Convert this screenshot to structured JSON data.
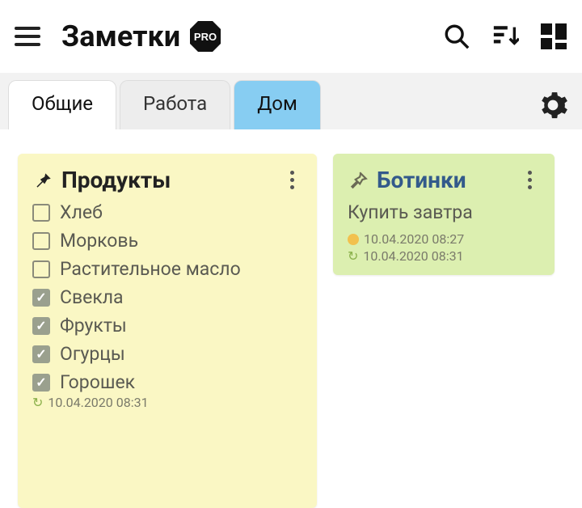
{
  "header": {
    "title": "Заметки",
    "badge": "PRO"
  },
  "tabs": [
    {
      "label": "Общие",
      "style": "active-white"
    },
    {
      "label": "Работа",
      "style": ""
    },
    {
      "label": "Дом",
      "style": "active-blue"
    }
  ],
  "notes": {
    "products": {
      "title": "Продукты",
      "items": [
        {
          "label": "Хлеб",
          "checked": false
        },
        {
          "label": "Морковь",
          "checked": false
        },
        {
          "label": "Растительное масло",
          "checked": false
        },
        {
          "label": "Свекла",
          "checked": true
        },
        {
          "label": "Фрукты",
          "checked": true
        },
        {
          "label": "Огурцы",
          "checked": true
        },
        {
          "label": "Горошек",
          "checked": true
        }
      ],
      "sync": "10.04.2020 08:31"
    },
    "boots": {
      "title": "Ботинки",
      "body": "Купить завтра",
      "reminder": "10.04.2020 08:27",
      "sync": "10.04.2020 08:31"
    }
  }
}
